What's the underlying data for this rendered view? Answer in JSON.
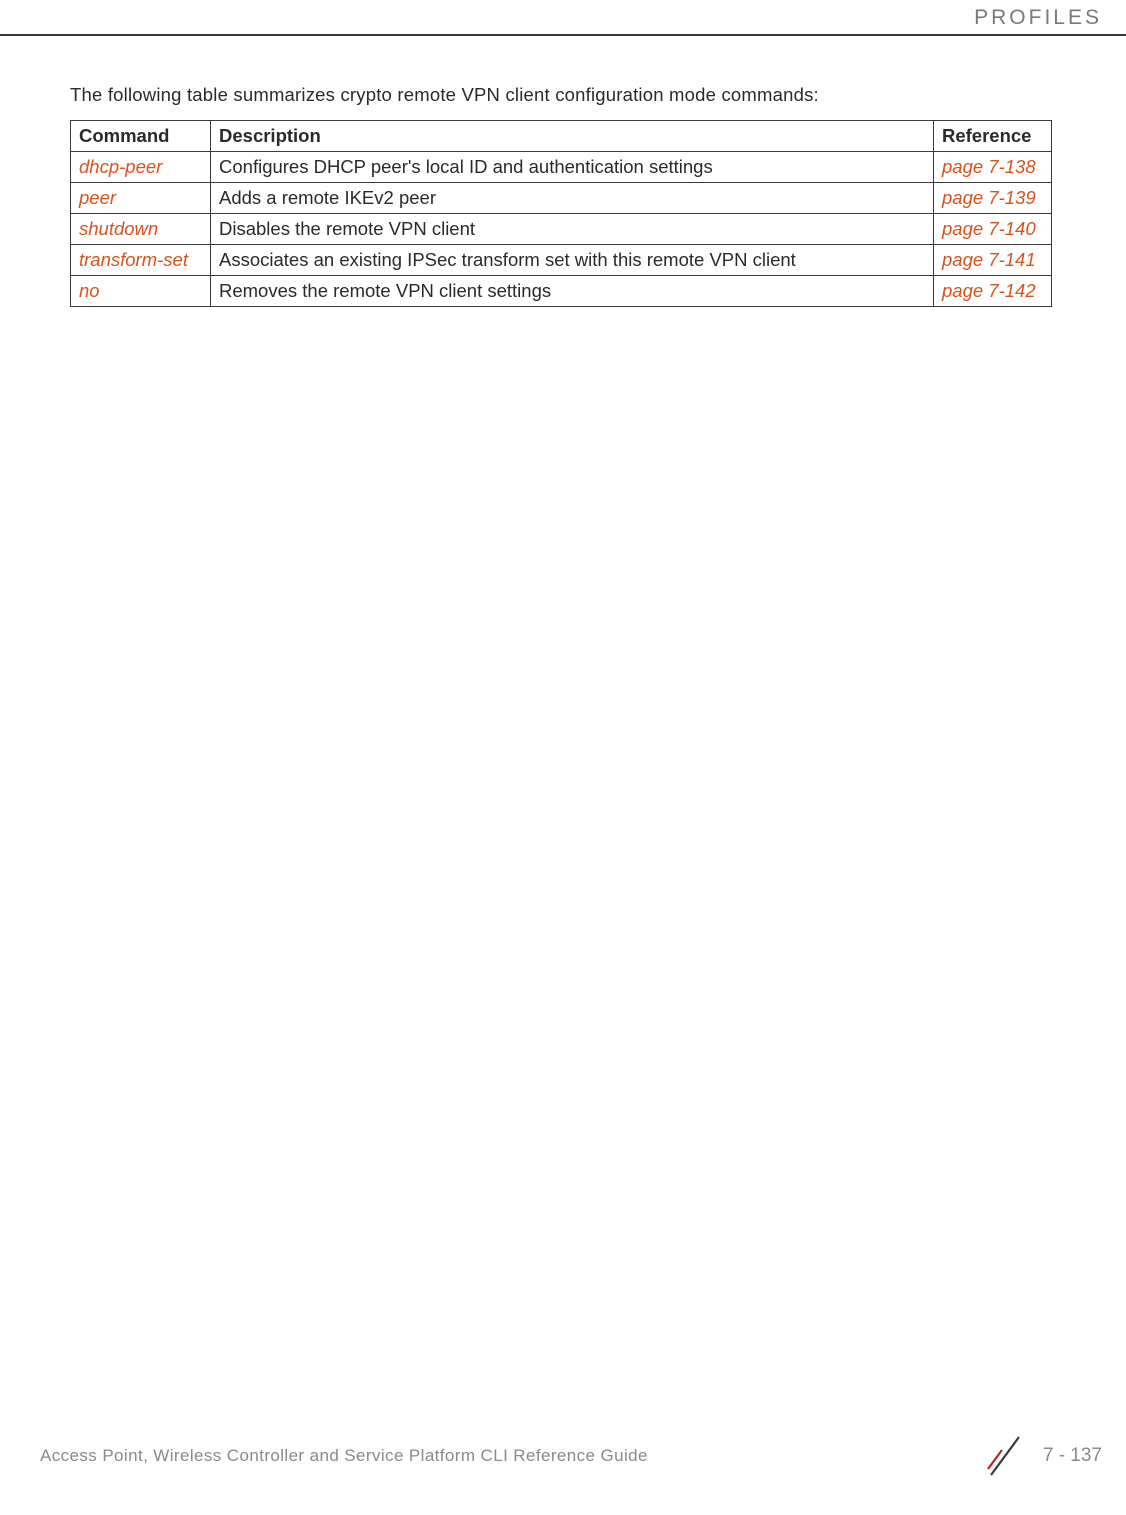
{
  "header": {
    "section_label": "PROFILES"
  },
  "content": {
    "intro": "The following table summarizes crypto remote VPN client configuration mode commands:",
    "table": {
      "headers": {
        "command": "Command",
        "description": "Description",
        "reference": "Reference"
      },
      "rows": [
        {
          "command": "dhcp-peer",
          "description": "Configures DHCP peer's local ID and authentication settings",
          "reference": "page 7-138"
        },
        {
          "command": "peer",
          "description": "Adds a remote IKEv2 peer",
          "reference": "page 7-139"
        },
        {
          "command": "shutdown",
          "description": "Disables the remote VPN client",
          "reference": "page 7-140"
        },
        {
          "command": "transform-set",
          "description": "Associates an existing IPSec transform set with this remote VPN client",
          "reference": "page 7-141"
        },
        {
          "command": "no",
          "description": "Removes the remote VPN client settings",
          "reference": "page 7-142"
        }
      ]
    }
  },
  "footer": {
    "document_title": "Access Point, Wireless Controller and Service Platform CLI Reference Guide",
    "page_number": "7 - 137"
  }
}
